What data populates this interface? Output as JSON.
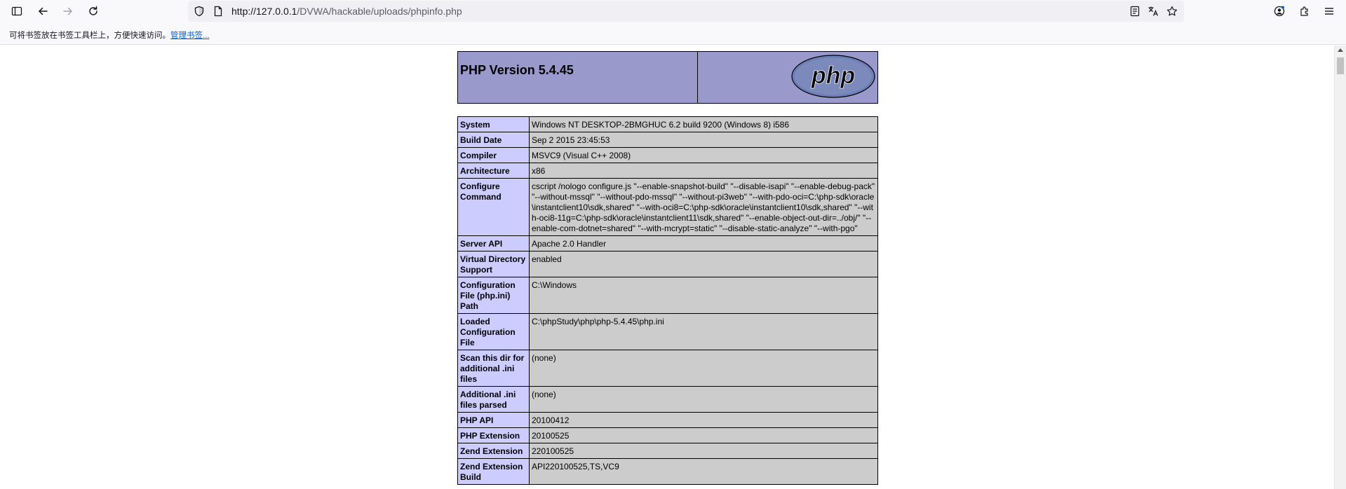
{
  "browser": {
    "url_host": "http://127.0.0.1",
    "url_path": "/DVWA/hackable/uploads/phpinfo.php",
    "bookmarks_hint": "可将书签放在书签工具栏上，方便快速访问。",
    "bookmarks_link": "管理书签..."
  },
  "phpinfo": {
    "version_title": "PHP Version 5.4.45",
    "logo_text": "php",
    "rows": [
      {
        "key": "System",
        "value": "Windows NT DESKTOP-2BMGHUC 6.2 build 9200 (Windows 8) i586"
      },
      {
        "key": "Build Date",
        "value": "Sep 2 2015 23:45:53"
      },
      {
        "key": "Compiler",
        "value": "MSVC9 (Visual C++ 2008)"
      },
      {
        "key": "Architecture",
        "value": "x86"
      },
      {
        "key": "Configure Command",
        "value": "cscript /nologo configure.js \"--enable-snapshot-build\" \"--disable-isapi\" \"--enable-debug-pack\" \"--without-mssql\" \"--without-pdo-mssql\" \"--without-pi3web\" \"--with-pdo-oci=C:\\php-sdk\\oracle\\instantclient10\\sdk,shared\" \"--with-oci8=C:\\php-sdk\\oracle\\instantclient10\\sdk,shared\" \"--with-oci8-11g=C:\\php-sdk\\oracle\\instantclient11\\sdk,shared\" \"--enable-object-out-dir=../obj/\" \"--enable-com-dotnet=shared\" \"--with-mcrypt=static\" \"--disable-static-analyze\" \"--with-pgo\""
      },
      {
        "key": "Server API",
        "value": "Apache 2.0 Handler"
      },
      {
        "key": "Virtual Directory Support",
        "value": "enabled"
      },
      {
        "key": "Configuration File (php.ini) Path",
        "value": "C:\\Windows"
      },
      {
        "key": "Loaded Configuration File",
        "value": "C:\\phpStudy\\php\\php-5.4.45\\php.ini"
      },
      {
        "key": "Scan this dir for additional .ini files",
        "value": "(none)"
      },
      {
        "key": "Additional .ini files parsed",
        "value": "(none)"
      },
      {
        "key": "PHP API",
        "value": "20100412"
      },
      {
        "key": "PHP Extension",
        "value": "20100525"
      },
      {
        "key": "Zend Extension",
        "value": "220100525"
      },
      {
        "key": "Zend Extension Build",
        "value": "API220100525,TS,VC9"
      }
    ]
  }
}
